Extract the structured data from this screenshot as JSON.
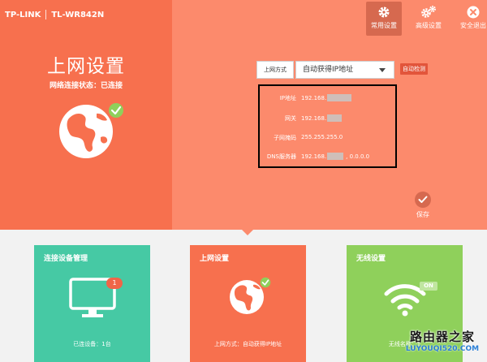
{
  "brand": {
    "logo": "TP-LINK",
    "model": "TL-WR842N"
  },
  "nav": [
    {
      "label": "常用设置",
      "icon": "gear-icon"
    },
    {
      "label": "高级设置",
      "icon": "gears-icon"
    },
    {
      "label": "安全退出",
      "icon": "close-icon"
    }
  ],
  "left": {
    "title": "上网设置",
    "status": "网络连接状态：已连接",
    "icon": "globe-check-icon"
  },
  "form": {
    "method_label": "上网方式",
    "method_value": "自动获得IP地址",
    "auto_detect": "自动检测",
    "rows": [
      {
        "label": "IP地址",
        "value": "192.168."
      },
      {
        "label": "网关",
        "value": "192.168."
      },
      {
        "label": "子网掩码",
        "value": "255.255.255.0"
      },
      {
        "label": "DNS服务器",
        "value": "192.168.",
        "value2": ", 0.0.0.0"
      }
    ],
    "save_label": "保存"
  },
  "cards": [
    {
      "title": "连接设备管理",
      "footer": "已连设备：1台",
      "badge": "1",
      "icon": "monitor-icon",
      "color": "#46c9a4"
    },
    {
      "title": "上网设置",
      "footer": "上网方式：自动获得IP地址",
      "icon": "globe-icon",
      "color": "#f7704e"
    },
    {
      "title": "无线设置",
      "footer": "无线名称：T",
      "badge": "ON",
      "icon": "wifi-icon",
      "color": "#8fd05b"
    }
  ],
  "watermark": {
    "line1": "路由器之家",
    "line2": "LUYOUQI520.COM"
  },
  "colors": {
    "top_bg": "#fc8a6c",
    "left_bg": "#f7704e",
    "check": "#8fd05b"
  }
}
